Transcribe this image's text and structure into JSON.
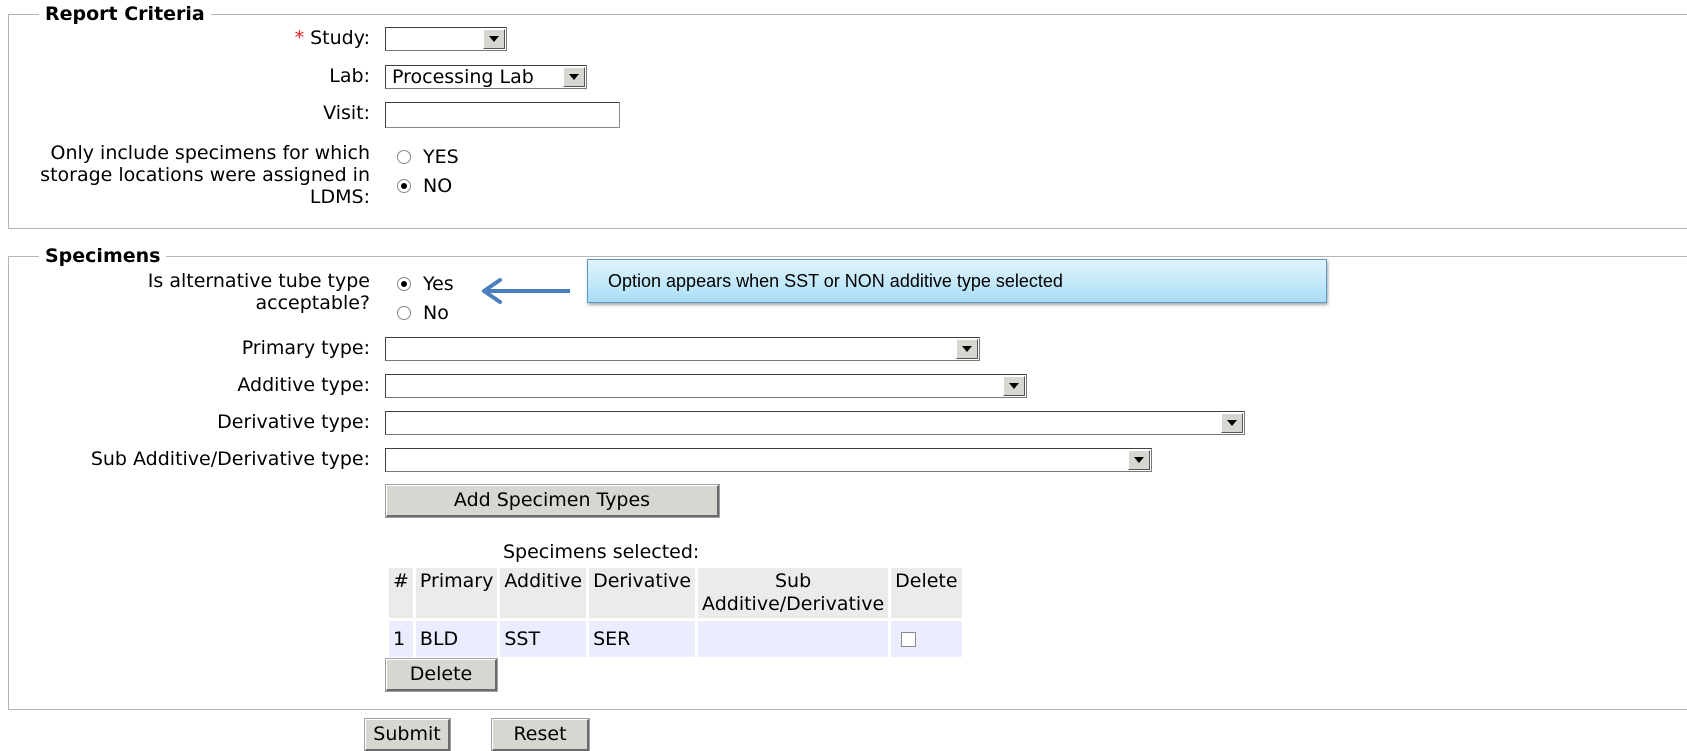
{
  "report_criteria": {
    "legend": "Report Criteria",
    "required_marker": "*",
    "study_label": "Study:",
    "study_value": "",
    "lab_label": "Lab:",
    "lab_value": "Processing Lab",
    "visit_label": "Visit:",
    "visit_value": "",
    "storage_label": "Only include specimens for which storage locations were assigned in LDMS:",
    "storage_yes": "YES",
    "storage_no": "NO",
    "storage_selected": "NO"
  },
  "specimens": {
    "legend": "Specimens",
    "alt_tube_label": "Is alternative tube type acceptable?",
    "alt_yes": "Yes",
    "alt_no": "No",
    "alt_selected": "Yes",
    "primary_label": "Primary type:",
    "primary_value": "",
    "additive_label": "Additive type:",
    "additive_value": "",
    "derivative_label": "Derivative type:",
    "derivative_value": "",
    "sub_label": "Sub Additive/Derivative type:",
    "sub_value": "",
    "add_button": "Add Specimen Types",
    "selected_caption": "Specimens selected:",
    "columns": [
      "#",
      "Primary",
      "Additive",
      "Derivative",
      "Sub Additive/Derivative",
      "Delete"
    ],
    "rows": [
      {
        "num": "1",
        "primary": "BLD",
        "additive": "SST",
        "derivative": "SER",
        "sub": "",
        "delete_checked": false
      }
    ],
    "delete_button": "Delete"
  },
  "actions": {
    "submit": "Submit",
    "reset": "Reset"
  },
  "annotation": {
    "text": "Option appears when SST or NON additive type selected",
    "arrow_color": "#4a7ebf",
    "box_border": "#5a9ac8"
  }
}
